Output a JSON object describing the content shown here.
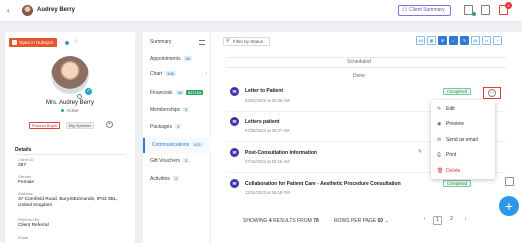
{
  "header": {
    "name": "Audrey Berry",
    "client_summary": "Client Summary",
    "notification_count": "9"
  },
  "profile": {
    "hubspot_label": "Open in Hubspot",
    "name": "Mrs. Audrey Berry",
    "status": "Active",
    "tags": [
      "Product Buyer",
      "Big Spender"
    ],
    "details_title": "Details",
    "details": [
      {
        "label": "Client ID",
        "value": "287"
      },
      {
        "label": "Gender",
        "value": "Female"
      },
      {
        "label": "Address",
        "value": "37 Cornfield Road, BuryStEdmunds, IP33 3BL, United Kingdom"
      },
      {
        "label": "Referred By",
        "value": "Client Referral"
      },
      {
        "label": "Email",
        "value": ""
      }
    ]
  },
  "tabs": [
    {
      "label": "Summary",
      "count": ""
    },
    {
      "label": "Appointments",
      "count": "65"
    },
    {
      "label": "Chart",
      "count": "406"
    },
    {
      "label": "Financials",
      "count": "46",
      "money": "$37184"
    },
    {
      "label": "Memberships",
      "count": "0"
    },
    {
      "label": "Packages",
      "count": "1"
    },
    {
      "label": "Communications",
      "count": "421"
    },
    {
      "label": "Gift Vouchers",
      "count": "3"
    },
    {
      "label": "Activities",
      "count": "3"
    }
  ],
  "main": {
    "filter_label": "Filter by Status",
    "view_icons": [
      "All",
      "calendar",
      "message",
      "check",
      "note",
      "email",
      "mail",
      "bell"
    ],
    "scheduled_label": "Scheduled",
    "done_label": "Done",
    "items": [
      {
        "title": "Letter to Patient",
        "date": "02/04/2025 at 05:35 AM",
        "status": "Completed"
      },
      {
        "title": "Letters patient",
        "date": "07/30/2024 at 06:07 AM",
        "status": ""
      },
      {
        "title": "Post-Consultation Information",
        "date": "07/16/2024 at 05:15 AM",
        "status": ""
      },
      {
        "title": "Collaboration for Patient Care - Aesthetic Procedure Consultation",
        "date": "12/24/2023 at 06:18 PM",
        "status": "Completed"
      }
    ]
  },
  "menu": {
    "items": [
      "Edit",
      "Preview",
      "Send as email",
      "Print",
      "Delete"
    ]
  },
  "pagination": {
    "showing_prefix": "SHOWING",
    "showing_count": "4",
    "showing_mid": "RESULTS FROM",
    "showing_total": "78",
    "rows_label": "ROWS PER PAGE",
    "rows_value": "50",
    "pages": [
      "1",
      "2"
    ]
  }
}
